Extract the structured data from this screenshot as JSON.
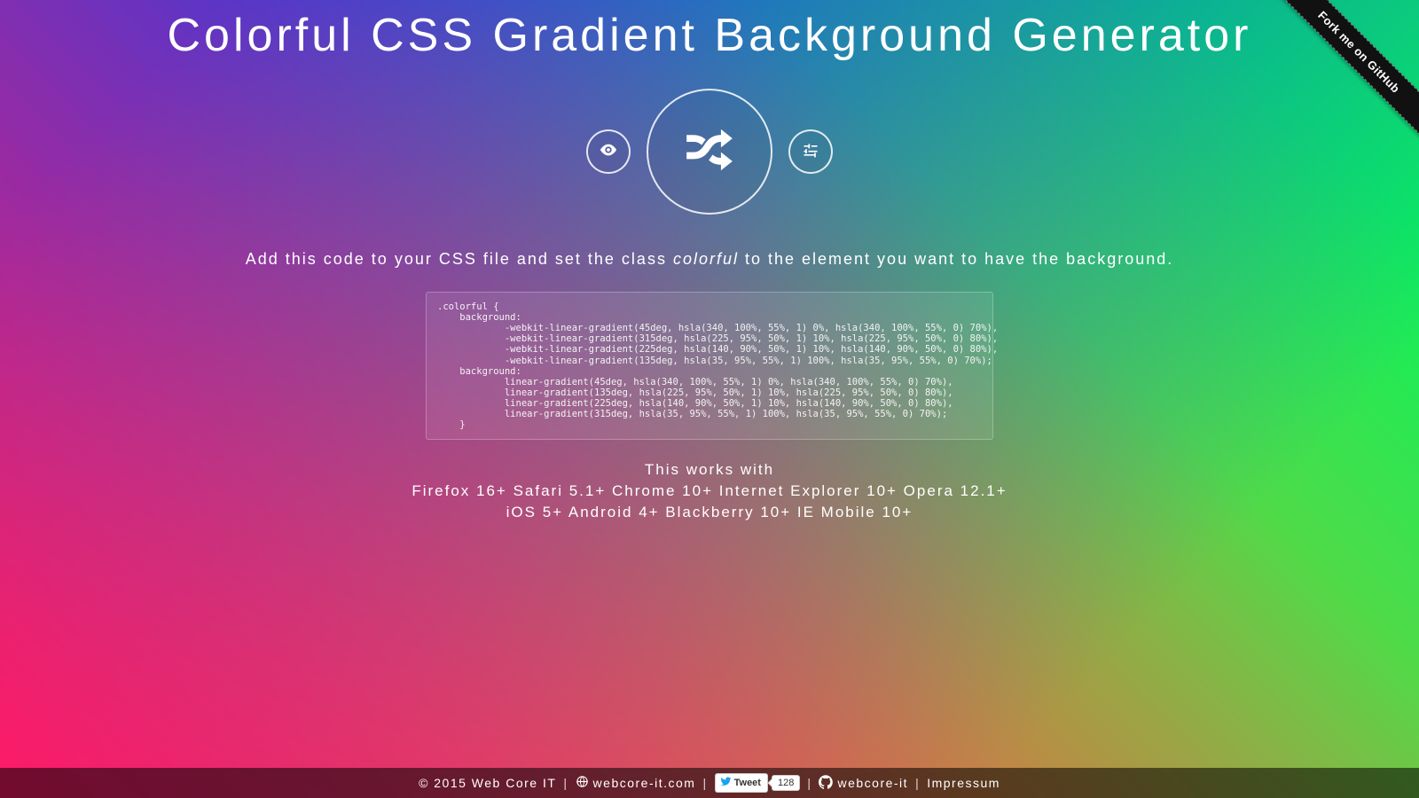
{
  "header": {
    "title": "Colorful CSS Gradient Background Generator"
  },
  "ribbon": {
    "label": "Fork me on GitHub"
  },
  "controls": {
    "preview": "preview",
    "shuffle": "shuffle",
    "settings": "settings"
  },
  "instruction": {
    "prefix": "Add this code to your CSS file and set the class ",
    "classname": "colorful",
    "suffix": " to the element you want to have the background."
  },
  "code": ".colorful {\n    background:\n            -webkit-linear-gradient(45deg, hsla(340, 100%, 55%, 1) 0%, hsla(340, 100%, 55%, 0) 70%),\n            -webkit-linear-gradient(315deg, hsla(225, 95%, 50%, 1) 10%, hsla(225, 95%, 50%, 0) 80%),\n            -webkit-linear-gradient(225deg, hsla(140, 90%, 50%, 1) 10%, hsla(140, 90%, 50%, 0) 80%),\n            -webkit-linear-gradient(135deg, hsla(35, 95%, 55%, 1) 100%, hsla(35, 95%, 55%, 0) 70%);\n    background:\n            linear-gradient(45deg, hsla(340, 100%, 55%, 1) 0%, hsla(340, 100%, 55%, 0) 70%),\n            linear-gradient(135deg, hsla(225, 95%, 50%, 1) 10%, hsla(225, 95%, 50%, 0) 80%),\n            linear-gradient(225deg, hsla(140, 90%, 50%, 1) 10%, hsla(140, 90%, 50%, 0) 80%),\n            linear-gradient(315deg, hsla(35, 95%, 55%, 1) 100%, hsla(35, 95%, 55%, 0) 70%);\n    }",
  "compatibility": {
    "heading": "This works with",
    "line1": "Firefox 16+ Safari 5.1+ Chrome 10+ Internet Explorer 10+ Opera 12.1+",
    "line2": "iOS 5+ Android 4+ Blackberry 10+ IE Mobile 10+"
  },
  "footer": {
    "copyright": "© 2015 Web Core IT",
    "site": "webcore-it.com",
    "tweet_label": "Tweet",
    "tweet_count": "128",
    "github_text": "webcore-it",
    "impressum": "Impressum"
  }
}
